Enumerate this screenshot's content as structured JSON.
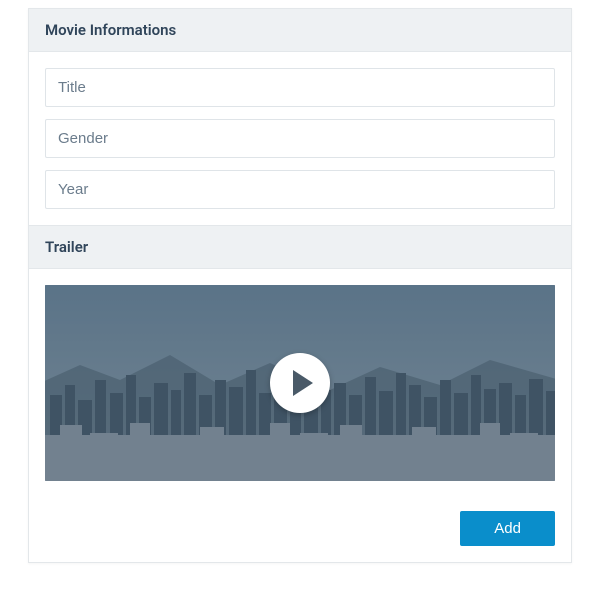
{
  "sections": {
    "info": {
      "header": "Movie Informations"
    },
    "trailer": {
      "header": "Trailer"
    }
  },
  "form": {
    "title": {
      "placeholder": "Title",
      "value": ""
    },
    "gender": {
      "placeholder": "Gender",
      "value": ""
    },
    "year": {
      "placeholder": "Year",
      "value": ""
    }
  },
  "buttons": {
    "add": "Add"
  },
  "trailer": {
    "hasVideo": true
  }
}
